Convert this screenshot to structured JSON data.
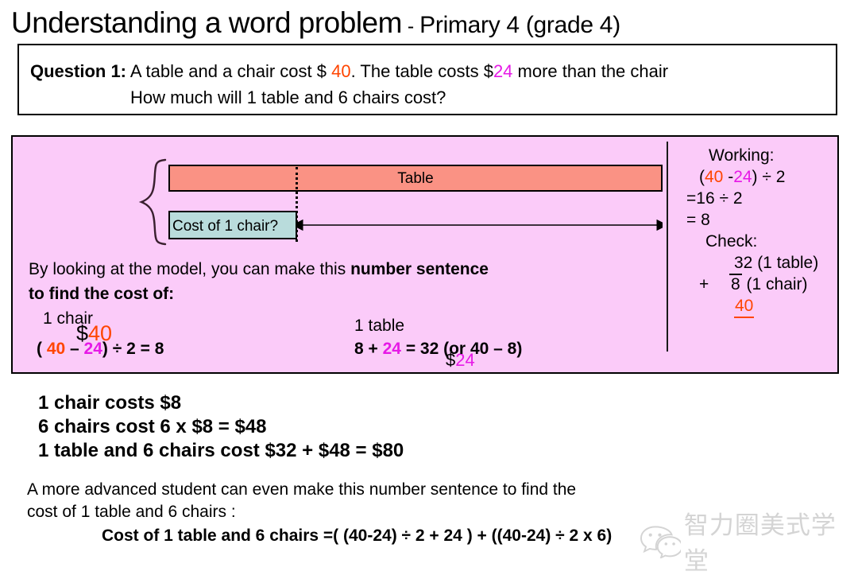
{
  "title": {
    "main": "Understanding a word problem",
    "separator": " - ",
    "sub": "Primary 4 (grade 4)"
  },
  "colors": {
    "value_40": "#ff4500",
    "value_24": "#e619e6",
    "panel_background": "#fbcbf9",
    "table_bar": "#fa9284",
    "chair_bar": "#b9dcdc",
    "page_background": "#ffffff"
  },
  "question": {
    "label": "Question 1:",
    "line1_a": " A table and a chair cost $ ",
    "line1_value_40": "40",
    "line1_b": ". The table costs $",
    "line1_value_24": "24",
    "line1_c": " more than the chair",
    "line2": "How much will 1 table and 6 chairs cost?"
  },
  "model": {
    "total_dollar": "$",
    "total_value": "40",
    "table_bar_label": "Table",
    "chair_bar_label": "Cost of 1 chair?",
    "difference_dollar": "$",
    "difference_value": "24"
  },
  "explanation": {
    "line1_a": "By looking at the model, you can make this  ",
    "line1_bold": "number sentence",
    "line2_bold": "to find the cost of:",
    "chair_label": "1 chair",
    "chair_eq_open": "( ",
    "chair_eq_40": "40",
    "chair_eq_mid": " – ",
    "chair_eq_24": "24",
    "chair_eq_tail": ") ÷ 2 = 8",
    "table_label": "1 table",
    "table_eq_head": "8 + ",
    "table_eq_24": "24",
    "table_eq_tail": " = 32 (or 40 – 8)"
  },
  "working": {
    "title": "Working:",
    "line1_open": "(",
    "line1_40": "40",
    "line1_mid": " -",
    "line1_24": "24",
    "line1_tail": ") ÷ 2",
    "line2": "=16 ÷ 2",
    "line3": "= 8",
    "check_title": "Check:",
    "check_row1": "32 (1 table)",
    "check_plus": "+",
    "check_row2_value": "8",
    "check_row2_note": " (1 chair)",
    "check_total": "40"
  },
  "answers": {
    "line1": "1 chair costs  $8",
    "line2": "6 chairs cost  6 x $8 = $48",
    "line3": "1 table and 6 chairs cost $32 + $48 = $80"
  },
  "footer": {
    "para_line1": "A more advanced student can even make this number sentence to find the",
    "para_line2": "cost of 1 table and  6 chairs :",
    "formula": "Cost of 1 table and 6 chairs =( (40-24) ÷ 2 + 24 ) + ((40-24) ÷ 2 x 6)"
  },
  "watermark": {
    "icon": "wechat-icon",
    "text": "智力圈美式学堂"
  }
}
